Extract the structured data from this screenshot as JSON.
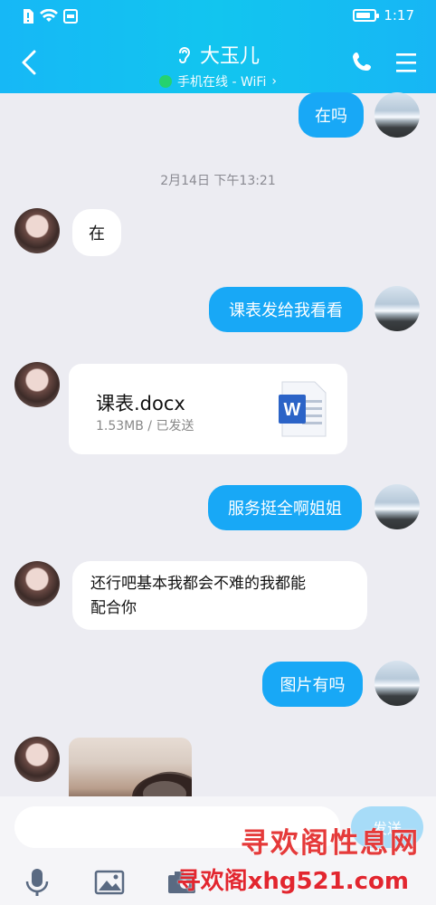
{
  "status_bar": {
    "time": "1:17",
    "battery_level": 0.8
  },
  "header": {
    "contact_name": "大玉儿",
    "online_status": "手机在线 - WiFi",
    "online_chevron": "›",
    "icons": [
      "back-icon",
      "ear-icon",
      "phone-icon",
      "menu-icon"
    ]
  },
  "messages": {
    "m1": "在吗",
    "timestamp": "2月14日 下午13:21",
    "m2": "在",
    "m3": "课表发给我看看",
    "file": {
      "name": "课表.docx",
      "meta": "1.53MB / 已发送",
      "icon_letter": "W"
    },
    "m4": "服务挺全啊姐姐",
    "m5_line1": "还行吧基本我都会不难的我都能",
    "m5_line2": "配合你",
    "m6": "图片有吗"
  },
  "input_bar": {
    "placeholder": "",
    "send_label": "发送"
  },
  "toolbar_icons": [
    "mic-icon",
    "image-icon",
    "camera-icon"
  ],
  "watermark": {
    "line1": "寻欢阁性息网",
    "line2": "寻欢阁xhg521.com"
  },
  "colors": {
    "header": "#16b8f6",
    "bubble_me": "#18a8f6",
    "bubble_her": "#ffffff",
    "background": "#ececf2",
    "online": "#27d36a"
  }
}
